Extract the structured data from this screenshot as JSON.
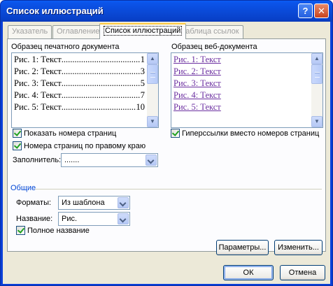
{
  "window": {
    "title": "Список иллюстраций",
    "help_glyph": "?",
    "close_glyph": "✕"
  },
  "tabs": [
    {
      "label": "Указатель",
      "active": false
    },
    {
      "label": "Оглавление",
      "active": false
    },
    {
      "label": "Список иллюстраций",
      "active": true
    },
    {
      "label": "Таблица ссылок",
      "active": false
    }
  ],
  "print_preview": {
    "label": "Образец печатного документа",
    "lines": [
      {
        "text": "Рис. 1: Текст",
        "page": "1"
      },
      {
        "text": "Рис. 2: Текст",
        "page": "3"
      },
      {
        "text": "Рис. 3: Текст",
        "page": "5"
      },
      {
        "text": "Рис. 4: Текст",
        "page": "7"
      },
      {
        "text": "Рис. 5: Текст",
        "page": "10"
      }
    ]
  },
  "web_preview": {
    "label": "Образец веб-документа",
    "lines": [
      "Рис. 1: Текст",
      "Рис. 2: Текст",
      "Рис. 3: Текст",
      "Рис. 4: Текст",
      "Рис. 5: Текст"
    ]
  },
  "options": {
    "show_page_numbers": {
      "label": "Показать номера страниц",
      "checked": true
    },
    "right_align": {
      "label": "Номера страниц по правому краю",
      "checked": true
    },
    "hyperlinks": {
      "label": "Гиперссылки вместо номеров страниц",
      "checked": true
    },
    "tab_leader_label": "Заполнитель:",
    "tab_leader_value": "......."
  },
  "general": {
    "title": "Общие",
    "formats_label": "Форматы:",
    "formats_value": "Из шаблона",
    "caption_label": "Название:",
    "caption_value": "Рис.",
    "full_caption": {
      "label": "Полное название",
      "checked": true
    }
  },
  "buttons": {
    "options": "Параметры...",
    "modify": "Изменить...",
    "ok": "ОК",
    "cancel": "Отмена"
  },
  "colors": {
    "title_bar": "#0a49d6",
    "hyperlink": "#6b2fa0",
    "group_title": "#0046d5"
  }
}
